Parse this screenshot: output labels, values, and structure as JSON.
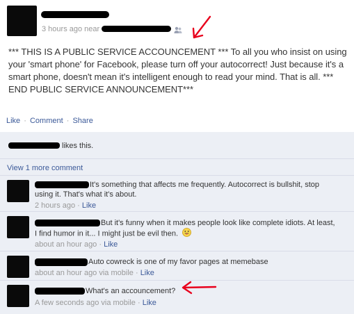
{
  "post": {
    "timestamp": "3 hours ago near",
    "body": "*** THIS IS A PUBLIC SERVICE ACCOUNCEMENT *** To all you who insist on using your 'smart phone' for Facebook, please turn off your autocorrect! Just because it's a smart phone, doesn't mean it's intelligent enough to read your mind. That is all. *** END PUBLIC SERVICE ANNOUNCEMENT***",
    "action_like": "Like",
    "action_comment": "Comment",
    "action_share": "Share",
    "separator": "·"
  },
  "likes": {
    "text": "likes this."
  },
  "view_more": "View 1 more comment",
  "comments": [
    {
      "line1": "It's something that affects me frequently. Autocorrect is bullshit, stop",
      "line2": "using it. That's what it's about.",
      "meta": "2 hours ago",
      "like": "Like"
    },
    {
      "line1": "But it's funny when it makes people look like complete idiots. At least,",
      "line2": "I find humor in it... I might just be evil then.",
      "meta": "about an hour ago",
      "like": "Like"
    },
    {
      "line1": "Auto cowreck is one of my favor pages at memebase",
      "meta": "about an hour ago via mobile",
      "like": "Like"
    },
    {
      "line1": "What's an accouncement?",
      "meta": "A few seconds ago via mobile",
      "like": "Like"
    }
  ],
  "colors": {
    "link": "#3b5998",
    "ufi_background": "#eceff5",
    "annotation_arrow": "#e8001c"
  },
  "icons": [
    "friends-icon",
    "annotation-arrow",
    "emoticon-tongue-icon"
  ]
}
